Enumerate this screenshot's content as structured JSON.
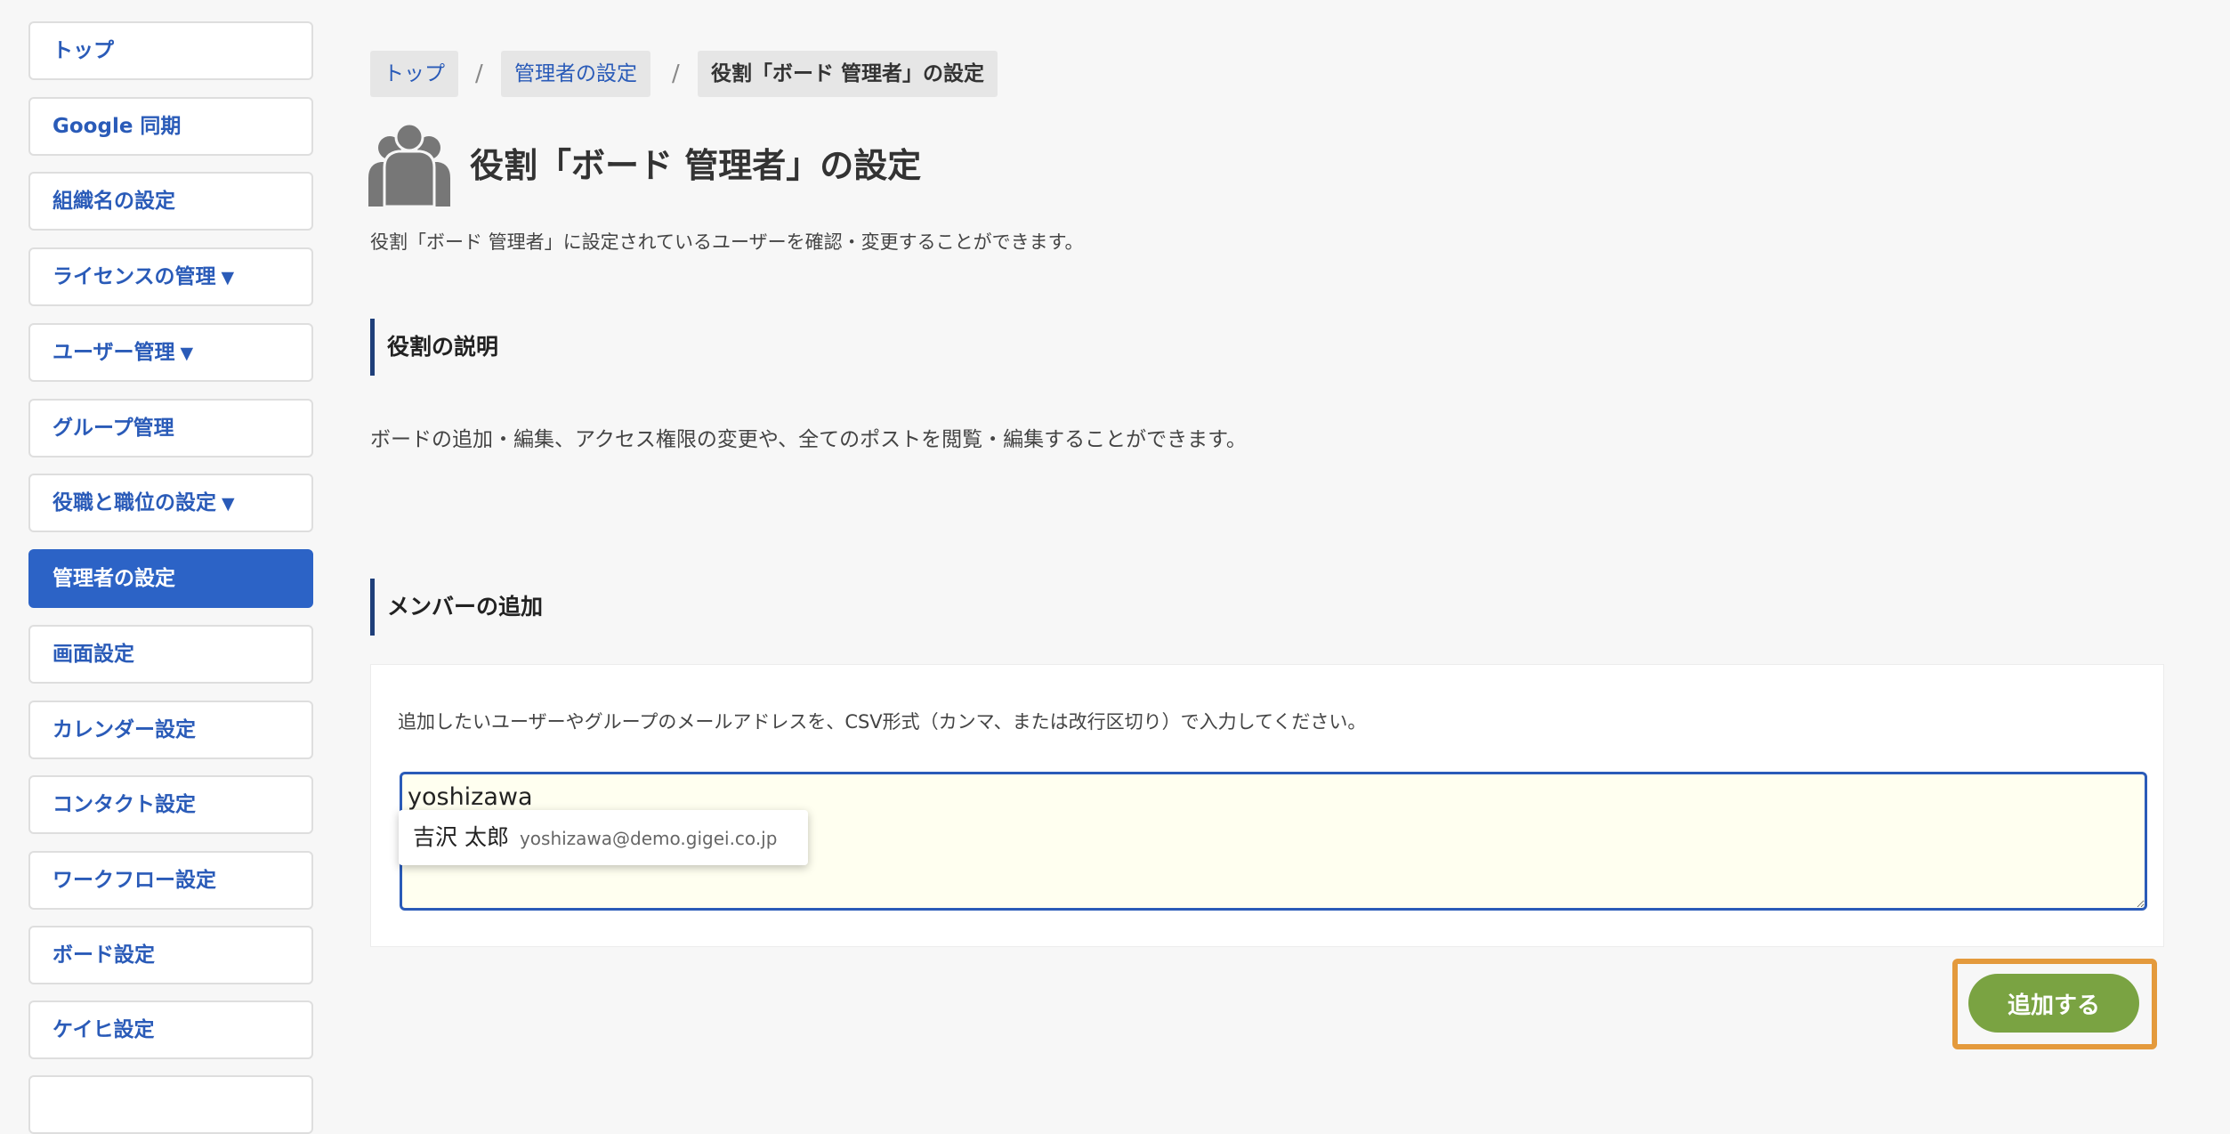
{
  "sidebar": {
    "items": [
      {
        "label": "トップ",
        "caret": ""
      },
      {
        "label": "Google 同期",
        "caret": ""
      },
      {
        "label": "組織名の設定",
        "caret": ""
      },
      {
        "label": "ライセンスの管理",
        "caret": "▼"
      },
      {
        "label": "ユーザー管理",
        "caret": "▼"
      },
      {
        "label": "グループ管理",
        "caret": ""
      },
      {
        "label": "役職と職位の設定",
        "caret": "▼"
      },
      {
        "label": "管理者の設定",
        "caret": "",
        "active": true
      },
      {
        "label": "画面設定",
        "caret": ""
      },
      {
        "label": "カレンダー設定",
        "caret": ""
      },
      {
        "label": "コンタクト設定",
        "caret": ""
      },
      {
        "label": "ワークフロー設定",
        "caret": ""
      },
      {
        "label": "ボード設定",
        "caret": ""
      },
      {
        "label": "ケイヒ設定",
        "caret": ""
      }
    ]
  },
  "breadcrumb": {
    "items": [
      "トップ",
      "管理者の設定",
      "役割「ボード 管理者」の設定"
    ],
    "separator": "/"
  },
  "page": {
    "icon": "users-group-icon",
    "title": "役割「ボード 管理者」の設定",
    "description": "役割「ボード 管理者」に設定されているユーザーを確認・変更することができます。"
  },
  "role_description": {
    "heading": "役割の説明",
    "text": "ボードの追加・編集、アクセス権限の変更や、全てのポストを閲覧・編集することができます。"
  },
  "member_add": {
    "heading": "メンバーの追加",
    "instruction": "追加したいユーザーやグループのメールアドレスを、CSV形式（カンマ、または改行区切り）で入力してください。",
    "input_value": "yoshizawa",
    "suggestion": {
      "name": "吉沢 太郎",
      "email": "yoshizawa@demo.gigei.co.jp"
    },
    "button_label": "追加する"
  },
  "colors": {
    "accent_blue": "#2c63c6",
    "button_green": "#7aa342",
    "highlight_orange": "#e49a3c",
    "textarea_bg": "#fffff0"
  }
}
